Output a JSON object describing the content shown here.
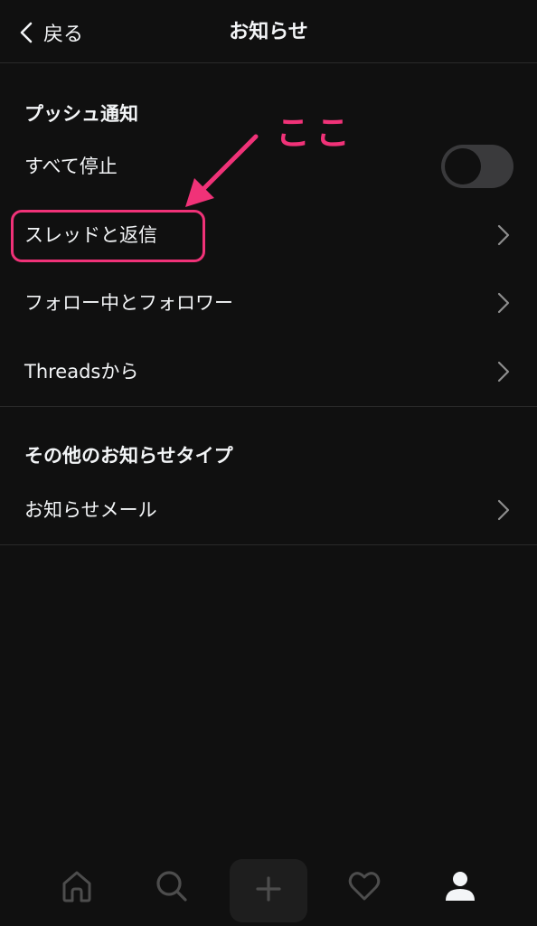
{
  "header": {
    "back_label": "戻る",
    "title": "お知らせ"
  },
  "push_section": {
    "heading": "プッシュ通知",
    "pause_all": {
      "label": "すべて停止",
      "toggle_on": false
    },
    "items": [
      {
        "label": "スレッドと返信"
      },
      {
        "label": "フォロー中とフォロワー"
      },
      {
        "label": "Threadsから"
      }
    ]
  },
  "other_section": {
    "heading": "その他のお知らせタイプ",
    "items": [
      {
        "label": "お知らせメール"
      }
    ]
  },
  "annotation": {
    "text": "ここ",
    "color": "#f03278"
  },
  "tabbar": {
    "icons": [
      "home-icon",
      "search-icon",
      "plus-icon",
      "heart-icon",
      "profile-icon"
    ],
    "active": "profile-icon"
  },
  "colors": {
    "background": "#101010",
    "text": "#f3f5f7",
    "divider": "#2a2a2a",
    "icon_inactive": "#4d4d4d",
    "icon_active": "#f3f5f7"
  }
}
